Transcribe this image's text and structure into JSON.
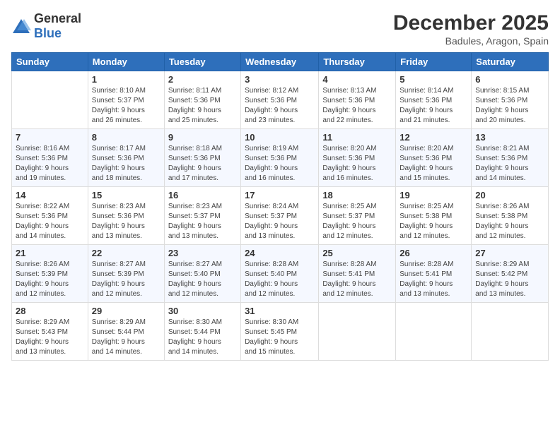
{
  "header": {
    "logo_general": "General",
    "logo_blue": "Blue",
    "month_title": "December 2025",
    "location": "Badules, Aragon, Spain"
  },
  "days_of_week": [
    "Sunday",
    "Monday",
    "Tuesday",
    "Wednesday",
    "Thursday",
    "Friday",
    "Saturday"
  ],
  "weeks": [
    [
      {
        "day": "",
        "info": ""
      },
      {
        "day": "1",
        "info": "Sunrise: 8:10 AM\nSunset: 5:37 PM\nDaylight: 9 hours\nand 26 minutes."
      },
      {
        "day": "2",
        "info": "Sunrise: 8:11 AM\nSunset: 5:36 PM\nDaylight: 9 hours\nand 25 minutes."
      },
      {
        "day": "3",
        "info": "Sunrise: 8:12 AM\nSunset: 5:36 PM\nDaylight: 9 hours\nand 23 minutes."
      },
      {
        "day": "4",
        "info": "Sunrise: 8:13 AM\nSunset: 5:36 PM\nDaylight: 9 hours\nand 22 minutes."
      },
      {
        "day": "5",
        "info": "Sunrise: 8:14 AM\nSunset: 5:36 PM\nDaylight: 9 hours\nand 21 minutes."
      },
      {
        "day": "6",
        "info": "Sunrise: 8:15 AM\nSunset: 5:36 PM\nDaylight: 9 hours\nand 20 minutes."
      }
    ],
    [
      {
        "day": "7",
        "info": "Sunrise: 8:16 AM\nSunset: 5:36 PM\nDaylight: 9 hours\nand 19 minutes."
      },
      {
        "day": "8",
        "info": "Sunrise: 8:17 AM\nSunset: 5:36 PM\nDaylight: 9 hours\nand 18 minutes."
      },
      {
        "day": "9",
        "info": "Sunrise: 8:18 AM\nSunset: 5:36 PM\nDaylight: 9 hours\nand 17 minutes."
      },
      {
        "day": "10",
        "info": "Sunrise: 8:19 AM\nSunset: 5:36 PM\nDaylight: 9 hours\nand 16 minutes."
      },
      {
        "day": "11",
        "info": "Sunrise: 8:20 AM\nSunset: 5:36 PM\nDaylight: 9 hours\nand 16 minutes."
      },
      {
        "day": "12",
        "info": "Sunrise: 8:20 AM\nSunset: 5:36 PM\nDaylight: 9 hours\nand 15 minutes."
      },
      {
        "day": "13",
        "info": "Sunrise: 8:21 AM\nSunset: 5:36 PM\nDaylight: 9 hours\nand 14 minutes."
      }
    ],
    [
      {
        "day": "14",
        "info": "Sunrise: 8:22 AM\nSunset: 5:36 PM\nDaylight: 9 hours\nand 14 minutes."
      },
      {
        "day": "15",
        "info": "Sunrise: 8:23 AM\nSunset: 5:36 PM\nDaylight: 9 hours\nand 13 minutes."
      },
      {
        "day": "16",
        "info": "Sunrise: 8:23 AM\nSunset: 5:37 PM\nDaylight: 9 hours\nand 13 minutes."
      },
      {
        "day": "17",
        "info": "Sunrise: 8:24 AM\nSunset: 5:37 PM\nDaylight: 9 hours\nand 13 minutes."
      },
      {
        "day": "18",
        "info": "Sunrise: 8:25 AM\nSunset: 5:37 PM\nDaylight: 9 hours\nand 12 minutes."
      },
      {
        "day": "19",
        "info": "Sunrise: 8:25 AM\nSunset: 5:38 PM\nDaylight: 9 hours\nand 12 minutes."
      },
      {
        "day": "20",
        "info": "Sunrise: 8:26 AM\nSunset: 5:38 PM\nDaylight: 9 hours\nand 12 minutes."
      }
    ],
    [
      {
        "day": "21",
        "info": "Sunrise: 8:26 AM\nSunset: 5:39 PM\nDaylight: 9 hours\nand 12 minutes."
      },
      {
        "day": "22",
        "info": "Sunrise: 8:27 AM\nSunset: 5:39 PM\nDaylight: 9 hours\nand 12 minutes."
      },
      {
        "day": "23",
        "info": "Sunrise: 8:27 AM\nSunset: 5:40 PM\nDaylight: 9 hours\nand 12 minutes."
      },
      {
        "day": "24",
        "info": "Sunrise: 8:28 AM\nSunset: 5:40 PM\nDaylight: 9 hours\nand 12 minutes."
      },
      {
        "day": "25",
        "info": "Sunrise: 8:28 AM\nSunset: 5:41 PM\nDaylight: 9 hours\nand 12 minutes."
      },
      {
        "day": "26",
        "info": "Sunrise: 8:28 AM\nSunset: 5:41 PM\nDaylight: 9 hours\nand 13 minutes."
      },
      {
        "day": "27",
        "info": "Sunrise: 8:29 AM\nSunset: 5:42 PM\nDaylight: 9 hours\nand 13 minutes."
      }
    ],
    [
      {
        "day": "28",
        "info": "Sunrise: 8:29 AM\nSunset: 5:43 PM\nDaylight: 9 hours\nand 13 minutes."
      },
      {
        "day": "29",
        "info": "Sunrise: 8:29 AM\nSunset: 5:44 PM\nDaylight: 9 hours\nand 14 minutes."
      },
      {
        "day": "30",
        "info": "Sunrise: 8:30 AM\nSunset: 5:44 PM\nDaylight: 9 hours\nand 14 minutes."
      },
      {
        "day": "31",
        "info": "Sunrise: 8:30 AM\nSunset: 5:45 PM\nDaylight: 9 hours\nand 15 minutes."
      },
      {
        "day": "",
        "info": ""
      },
      {
        "day": "",
        "info": ""
      },
      {
        "day": "",
        "info": ""
      }
    ]
  ]
}
